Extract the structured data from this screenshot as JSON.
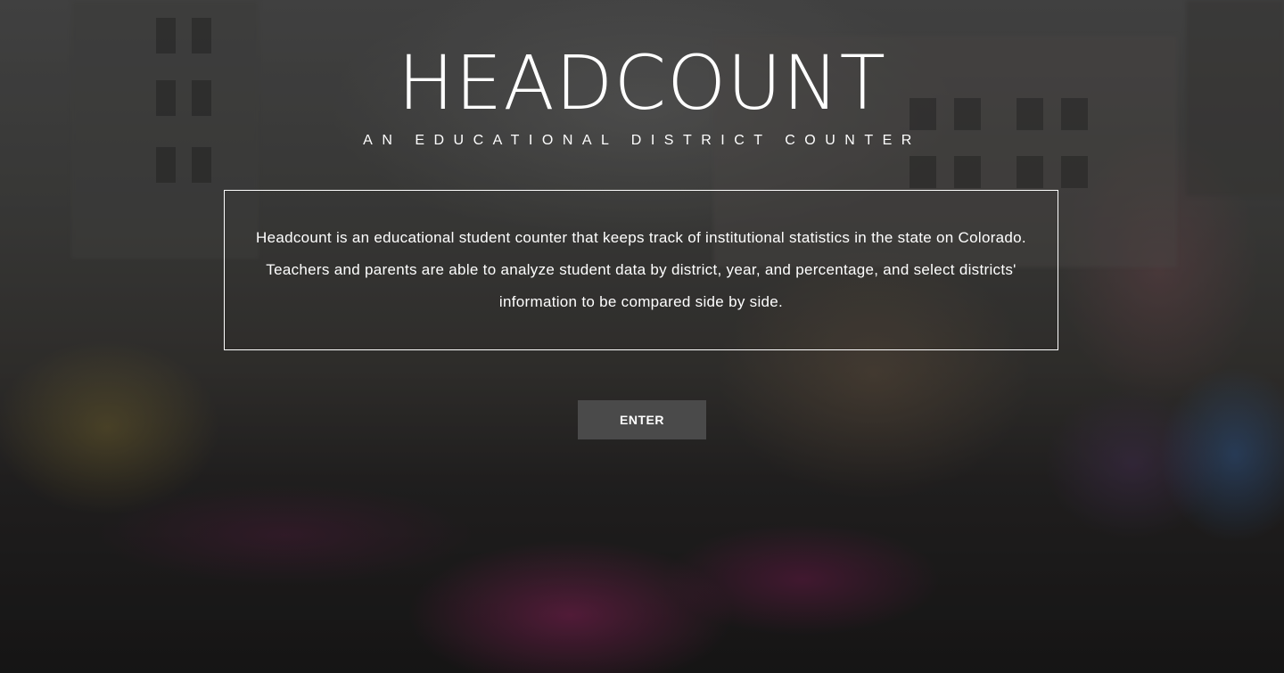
{
  "hero": {
    "title": "HEADCOUNT",
    "subtitle": "AN EDUCATIONAL DISTRICT COUNTER",
    "description": "Headcount is an educational student counter that keeps track of institutional statistics in the state on Colorado. Teachers and parents are able to analyze student data by district, year, and percentage, and select districts' information to be compared side by side.",
    "enter_label": "ENTER"
  },
  "colors": {
    "text": "#ffffff",
    "button_bg": "#4a4a4a",
    "box_border": "#ffffff"
  }
}
